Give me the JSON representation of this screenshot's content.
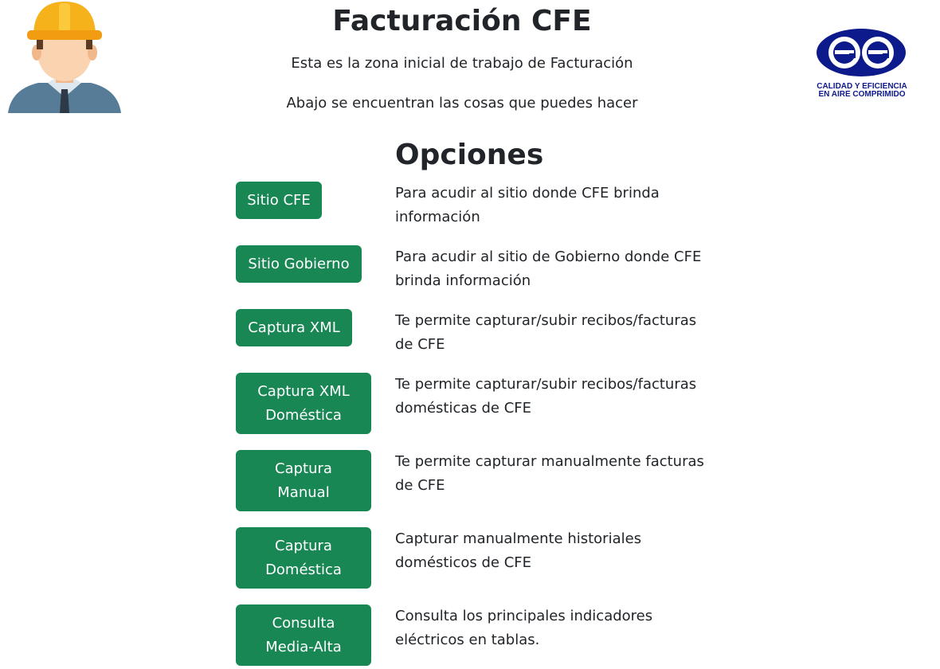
{
  "header": {
    "title": "Facturación CFE",
    "intro": "Esta es la zona inicial de trabajo de Facturación",
    "below": "Abajo se encuentran las cosas que puedes hacer"
  },
  "logo": {
    "line1": "CALIDAD Y EFICIENCIA",
    "line2": "EN AIRE COMPRIMIDO",
    "color": "#0d1a8c"
  },
  "options": {
    "title": "Opciones",
    "items": [
      {
        "label": "Sitio CFE",
        "desc": "Para acudir al sitio donde CFE brinda información"
      },
      {
        "label": "Sitio Gobierno",
        "desc": "Para acudir al sitio de Gobierno donde CFE brinda información"
      },
      {
        "label": "Captura XML",
        "desc": "Te permite capturar/subir recibos/facturas de CFE"
      },
      {
        "label": "Captura XML Doméstica",
        "desc": "Te permite capturar/subir recibos/facturas domésticas de CFE"
      },
      {
        "label": "Captura Manual",
        "desc": "Te permite capturar manualmente facturas de CFE"
      },
      {
        "label": "Captura Doméstica",
        "desc": "Capturar manualmente historiales domésticos de CFE"
      },
      {
        "label": "Consulta Media-Alta",
        "desc": "Consulta los principales indicadores eléctricos en tablas."
      }
    ]
  },
  "colors": {
    "button": "#198754",
    "button_text": "#ffffff",
    "helmet": "#f6b21b",
    "shirt": "#567c97"
  }
}
